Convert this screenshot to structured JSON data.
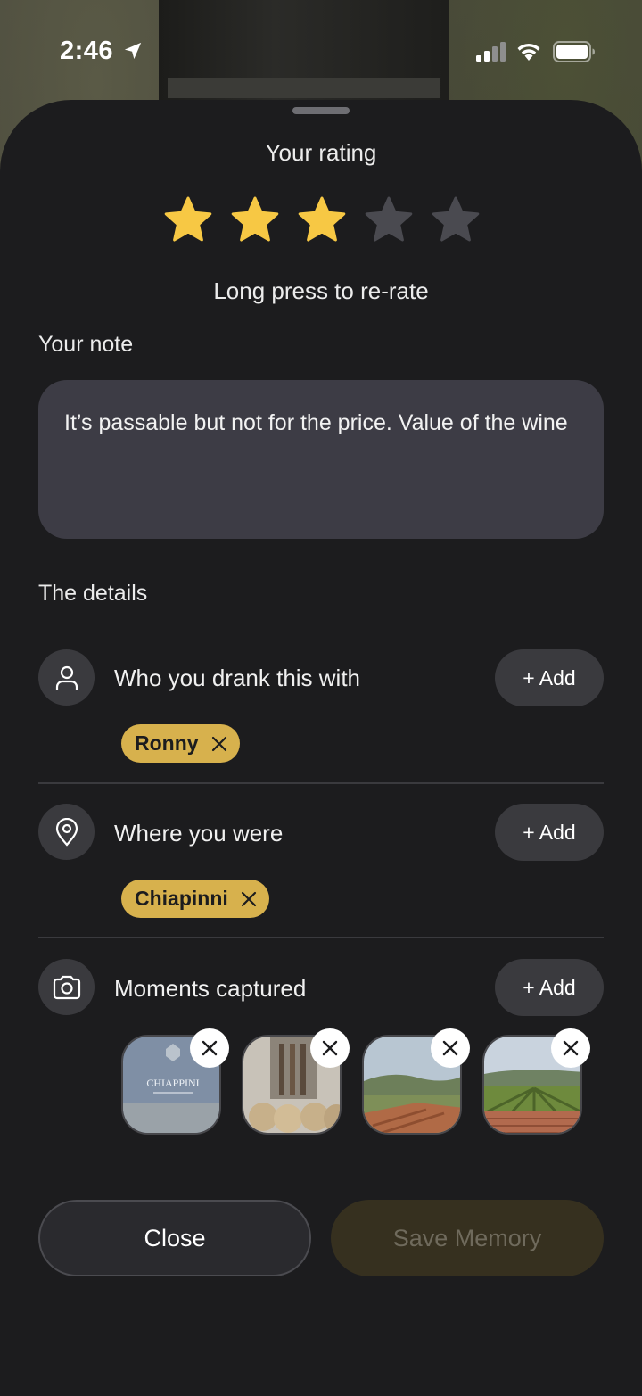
{
  "status_bar": {
    "time": "2:46"
  },
  "rating": {
    "title": "Your rating",
    "value": 3,
    "max": 5,
    "hint": "Long press to re-rate",
    "filled_color": "#f7c844",
    "empty_color": "#4a4a50"
  },
  "note": {
    "label": "Your note",
    "value": "It’s passable but not for the price. Value of the wine"
  },
  "details": {
    "label": "The details",
    "who": {
      "label": "Who you drank this with",
      "add_label": "+ Add",
      "chip": "Ronny"
    },
    "where": {
      "label": "Where you were",
      "add_label": "+ Add",
      "chip": "Chiapinni"
    },
    "moments": {
      "label": "Moments captured",
      "add_label": "+ Add",
      "photo_1_text": "CHIAPPINI",
      "photo_count": 4
    }
  },
  "actions": {
    "close_label": "Close",
    "save_label": "Save Memory"
  },
  "colors": {
    "accent": "#d7b14d",
    "sheet": "#1c1c1e"
  }
}
